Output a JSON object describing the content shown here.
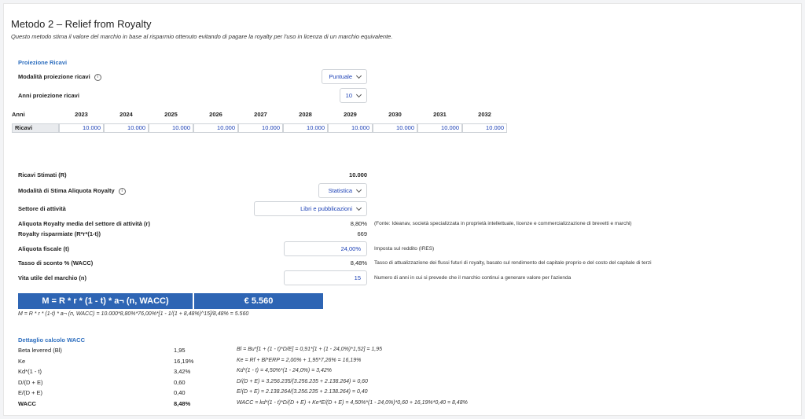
{
  "header": {
    "title": "Metodo 2 – Relief from Royalty",
    "subtitle": "Questo metodo stima il valore del marchio in base al risparmio ottenuto evitando di pagare la royalty per l'uso in licenza di un marchio equivalente."
  },
  "projection": {
    "section_title": "Proiezione Ricavi",
    "mode_label": "Modalità proiezione ricavi",
    "mode_value": "Puntuale",
    "years_label": "Anni proiezione ricavi",
    "years_value": "10",
    "years_header": "Anni",
    "revenue_label": "Ricavi",
    "years": [
      "2023",
      "2024",
      "2025",
      "2026",
      "2027",
      "2028",
      "2029",
      "2030",
      "2031",
      "2032"
    ],
    "revenues": [
      "10.000",
      "10.000",
      "10.000",
      "10.000",
      "10.000",
      "10.000",
      "10.000",
      "10.000",
      "10.000",
      "10.000"
    ]
  },
  "royalty": {
    "est_revenue_label": "Ricavi Stimati (R)",
    "est_revenue_value": "10.000",
    "mode_label": "Modalità di Stima Aliquota Royalty",
    "mode_value": "Statistica",
    "sector_label": "Settore di attività",
    "sector_value": "Libri e pubblicazioni",
    "avg_rate_label": "Aliquota Royalty media del settore di attività (r)",
    "avg_rate_value": "8,80%",
    "avg_rate_note": "(Fonte: Ideanav, società specializzata in proprietà intellettuale, licenze e commercializzazione di brevetti e marchi)",
    "saved_label": "Royalty risparmiate (R*r*(1-t))",
    "saved_value": "669",
    "tax_label": "Aliquota fiscale (t)",
    "tax_value": "24,00%",
    "tax_note": "Imposta sul reddito (IRES)",
    "wacc_label": "Tasso di sconto % (WACC)",
    "wacc_value": "8,48%",
    "wacc_note": "Tasso di attualizzazione dei flussi futuri di royalty, basato sul rendimento del capitale proprio e del costo del capitale di terzi",
    "life_label": "Vita utile del marchio (n)",
    "life_value": "15",
    "life_note": "Numero di anni in cui si prevede che il marchio continui a generare valore per l'azienda"
  },
  "result": {
    "formula_label": "M = R * r * (1 - t) * a¬ (n, WACC)",
    "value": "€ 5.560",
    "formula_detail": "M = R * r * (1-t) * a¬ (n, WACC) = 10.000*8,80%*76,00%*[1 - 1/(1 + 8,48%)^15]/8,48% = 5.560"
  },
  "wacc_detail": {
    "section_title": "Dettaglio calcolo WACC",
    "rows": [
      {
        "label": "Beta levered (Bl)",
        "value": "1,95",
        "formula": "Bl = Bu*[1 + (1 - t)*D/E] = 0,91*[1 + (1 - 24,0%)*1,52] = 1,95"
      },
      {
        "label": "Ke",
        "value": "16,19%",
        "formula": "Ke = Rf + Bl*ERP = 2,00% + 1,95*7,26% = 16,19%"
      },
      {
        "label": "Kd*(1 - t)",
        "value": "3,42%",
        "formula": "Kd*(1 - t) = 4,50%*(1 - 24,0%) = 3,42%"
      },
      {
        "label": "D/(D + E)",
        "value": "0,60",
        "formula": "D/(D + E) = 3.256.235/(3.256.235 + 2.138.264) = 0,60"
      },
      {
        "label": "E/(D + E)",
        "value": "0,40",
        "formula": "E/(D + E) = 2.138.264/(3.256.235 + 2.138.264) = 0,40"
      },
      {
        "label": "WACC",
        "value": "8,48%",
        "formula": "WACC = kd*(1 - t)*D/(D + E) + Ke*E/(D + E) = 4,50%*(1 - 24,0%)*0,60 + 16,19%*0,40 = 8,48%"
      }
    ]
  },
  "icons": {
    "info": "i"
  }
}
